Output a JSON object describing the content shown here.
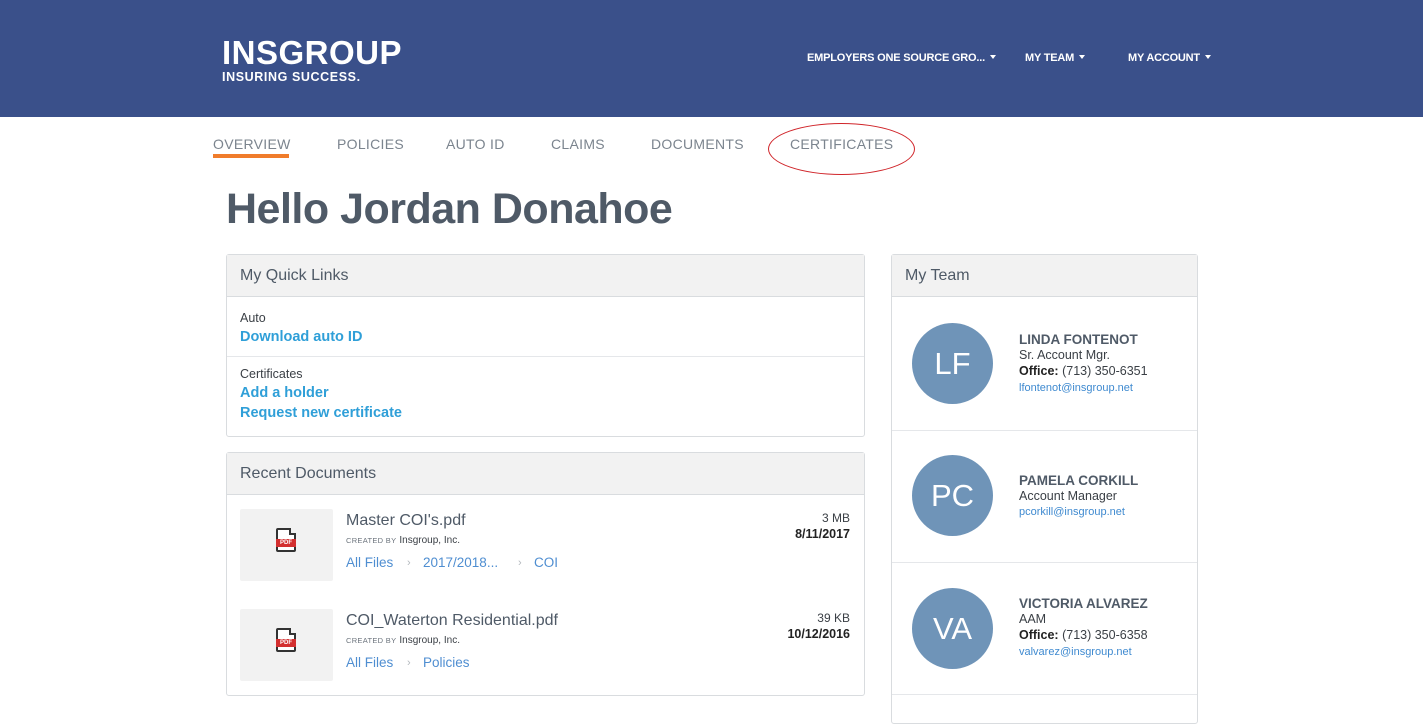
{
  "header": {
    "logo_main": "INSGROUP",
    "logo_tagline": "INSURING SUCCESS.",
    "menus": [
      {
        "label": "EMPLOYERS ONE SOURCE GRO..."
      },
      {
        "label": "MY TEAM"
      },
      {
        "label": "MY ACCOUNT"
      }
    ]
  },
  "tabs": [
    {
      "label": "OVERVIEW"
    },
    {
      "label": "POLICIES"
    },
    {
      "label": "AUTO ID"
    },
    {
      "label": "CLAIMS"
    },
    {
      "label": "DOCUMENTS"
    },
    {
      "label": "CERTIFICATES"
    }
  ],
  "colors": {
    "header_bg": "#3a508a",
    "active_tab_underline": "#f07c2b",
    "link": "#2f9fd8",
    "annotation_circle": "#d0252a",
    "avatar_bg": "#6f94b8"
  },
  "greeting": "Hello Jordan Donahoe",
  "quick_links": {
    "title": "My Quick Links",
    "groups": [
      {
        "label": "Auto",
        "links": [
          "Download auto ID"
        ]
      },
      {
        "label": "Certificates",
        "links": [
          "Add a holder",
          "Request new certificate"
        ]
      }
    ]
  },
  "recent_documents": {
    "title": "Recent Documents",
    "created_by_label": "CREATED BY",
    "items": [
      {
        "name": "Master COI's.pdf",
        "creator": "Insgroup, Inc.",
        "size": "3 MB",
        "date": "8/11/2017",
        "breadcrumbs": [
          "All Files",
          "2017/2018...",
          "COI"
        ],
        "icon": "pdf-icon"
      },
      {
        "name": "COI_Waterton Residential.pdf",
        "creator": "Insgroup, Inc.",
        "size": "39 KB",
        "date": "10/12/2016",
        "breadcrumbs": [
          "All Files",
          "Policies"
        ],
        "icon": "pdf-icon"
      }
    ]
  },
  "team": {
    "title": "My Team",
    "office_label": "Office:",
    "members": [
      {
        "initials": "LF",
        "name": "LINDA FONTENOT",
        "role": "Sr. Account Mgr.",
        "phone": "(713) 350-6351",
        "email": "lfontenot@insgroup.net"
      },
      {
        "initials": "PC",
        "name": "PAMELA CORKILL",
        "role": "Account Manager",
        "phone": "",
        "email": "pcorkill@insgroup.net"
      },
      {
        "initials": "VA",
        "name": "VICTORIA ALVAREZ",
        "role": "AAM",
        "phone": "(713) 350-6358",
        "email": "valvarez@insgroup.net"
      }
    ]
  }
}
